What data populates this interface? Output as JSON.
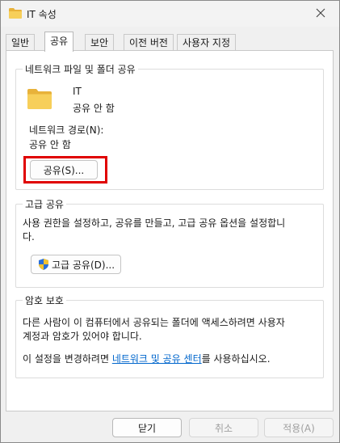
{
  "window": {
    "title": "IT 속성",
    "title_icon": "folder-icon",
    "close_icon": "close-icon"
  },
  "tabs": [
    {
      "label": "일반",
      "active": false
    },
    {
      "label": "공유",
      "active": true
    },
    {
      "label": "보안",
      "active": false
    },
    {
      "label": "이전 버전",
      "active": false
    },
    {
      "label": "사용자 지정",
      "active": false
    }
  ],
  "network_share": {
    "group_title": "네트워크 파일 및 폴더 공유",
    "folder_name": "IT",
    "folder_status": "공유 안 함",
    "path_label": "네트워크 경로(N):",
    "path_value": "공유 안 함",
    "share_button": "공유(S)..."
  },
  "advanced_share": {
    "group_title": "고급 공유",
    "description_line1": "사용 권한을 설정하고, 공유를 만들고, 고급 공유 옵션을 설정합니",
    "description_line2": "다.",
    "button": "고급 공유(D)...",
    "button_icon": "uac-shield-icon"
  },
  "password_protection": {
    "group_title": "암호 보호",
    "line1": "다른 사람이 이 컴퓨터에서 공유되는 폴더에 액세스하려면 사용자",
    "line2": "계정과 암호가 있어야 합니다.",
    "line3_prefix": "이 설정을 변경하려면 ",
    "link": "네트워크 및 공유 센터",
    "line3_suffix": "를 사용하십시오."
  },
  "footer": {
    "close_button": "닫기",
    "cancel_button": "취소",
    "apply_button": "적용(A)"
  },
  "colors": {
    "highlight": "#e00000",
    "link": "#0066cc",
    "folder": "#f4c542"
  }
}
